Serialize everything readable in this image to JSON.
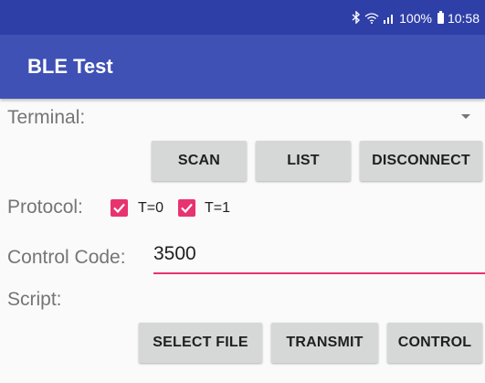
{
  "status_bar": {
    "bluetooth": "bluetooth-icon",
    "wifi": "wifi-icon",
    "signal": "signal-icon",
    "battery_text": "100%",
    "time": "10:58"
  },
  "app_bar": {
    "title": "BLE Test"
  },
  "terminal": {
    "label": "Terminal:",
    "selected_value": ""
  },
  "buttons_row1": {
    "scan": "SCAN",
    "list": "LIST",
    "disconnect": "DISCONNECT"
  },
  "protocol": {
    "label": "Protocol:",
    "options": [
      {
        "label": "T=0",
        "checked": true
      },
      {
        "label": "T=1",
        "checked": true
      }
    ]
  },
  "control_code": {
    "label": "Control Code:",
    "value": "3500"
  },
  "script": {
    "label": "Script:"
  },
  "buttons_row2": {
    "select_file": "SELECT FILE",
    "transmit": "TRANSMIT",
    "control": "CONTROL"
  },
  "colors": {
    "primary": "#3f51b5",
    "primary_dark": "#2f3fa8",
    "accent": "#e8336f",
    "button": "#d6d7d7"
  }
}
